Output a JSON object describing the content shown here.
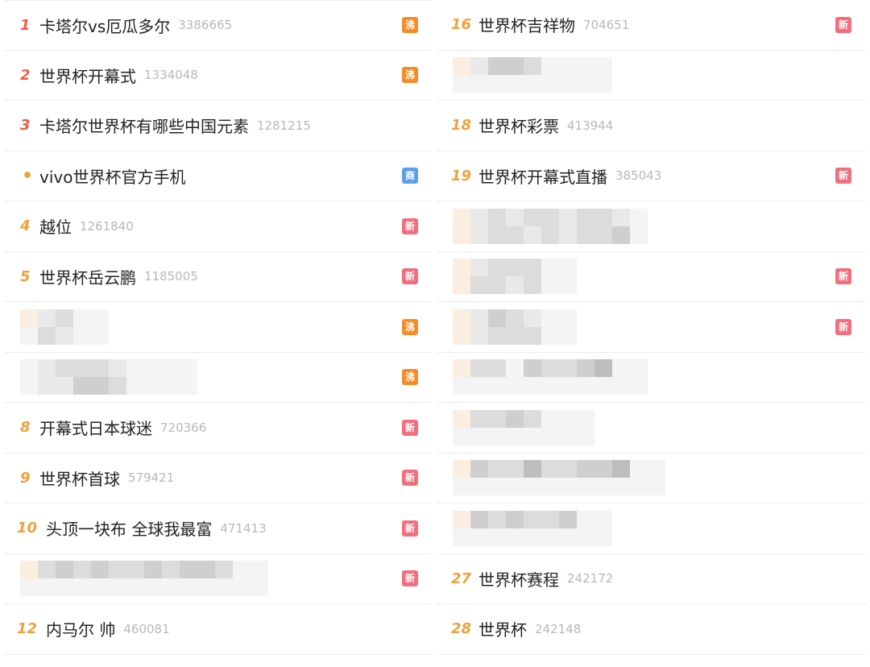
{
  "left_list": [
    {
      "rank": "1",
      "rank_style": "top",
      "title": "卡塔尔vs厄瓜多尔",
      "heat": "3386665",
      "badge": "沸",
      "badge_type": "hot"
    },
    {
      "rank": "2",
      "rank_style": "top",
      "title": "世界杯开幕式",
      "heat": "1334048",
      "badge": "沸",
      "badge_type": "hot"
    },
    {
      "rank": "3",
      "rank_style": "top",
      "title": "卡塔尔世界杯有哪些中国元素",
      "heat": "1281215",
      "badge": "",
      "badge_type": ""
    },
    {
      "rank": "•",
      "rank_style": "dot",
      "title": "vivo世界杯官方手机",
      "heat": "",
      "badge": "商",
      "badge_type": "ad"
    },
    {
      "rank": "4",
      "rank_style": "normal",
      "title": "越位",
      "heat": "1261840",
      "badge": "新",
      "badge_type": "new"
    },
    {
      "rank": "5",
      "rank_style": "normal",
      "title": "世界杯岳云鹏",
      "heat": "1185005",
      "badge": "新",
      "badge_type": "new"
    },
    {
      "blurred": true,
      "pattern": "c0c4c1c2c2c1c4c4c4c4",
      "badge": "沸",
      "badge_type": "hot"
    },
    {
      "blurred": true,
      "pattern": "c4c4c1c1c2c1c2c3c2c3c1c2c4c4c4c4c4c4c4c4",
      "badge": "沸",
      "badge_type": "hot"
    },
    {
      "rank": "8",
      "rank_style": "normal",
      "title": "开幕式日本球迷",
      "heat": "720366",
      "badge": "新",
      "badge_type": "new"
    },
    {
      "rank": "9",
      "rank_style": "normal",
      "title": "世界杯首球",
      "heat": "579421",
      "badge": "新",
      "badge_type": "new"
    },
    {
      "rank": "10",
      "rank_style": "normal",
      "title": "头顶一块布 全球我最富",
      "heat": "471413",
      "badge": "新",
      "badge_type": "new"
    },
    {
      "blurred": true,
      "pattern": "c0c4c2c4c3c4c2c4c3c4c2c4c2c4c3c4c2c4c3c4c3c4c2c4c4c4c4c4",
      "badge": "新",
      "badge_type": "new"
    },
    {
      "rank": "12",
      "rank_style": "normal",
      "title": "内马尔 帅",
      "heat": "460081",
      "badge": "",
      "badge_type": ""
    }
  ],
  "right_list": [
    {
      "rank": "16",
      "rank_style": "normal",
      "title": "世界杯吉祥物",
      "heat": "704651",
      "badge": "新",
      "badge_type": "new"
    },
    {
      "blurred": true,
      "pattern": "c0c4c1c4c3c4c3c4c2c4c4c4c4c4c4c4c4c4",
      "badge": "",
      "badge_type": ""
    },
    {
      "rank": "18",
      "rank_style": "normal",
      "title": "世界杯彩票",
      "heat": "413944",
      "badge": "",
      "badge_type": ""
    },
    {
      "rank": "19",
      "rank_style": "normal",
      "title": "世界杯开幕式直播",
      "heat": "385043",
      "badge": "新",
      "badge_type": "new"
    },
    {
      "blurred": true,
      "pattern": "c0c0c1c1c2c2c1c2c2c1c2c2c1c1c2c2c2c2c1c3c4c4",
      "badge": "",
      "badge_type": ""
    },
    {
      "blurred": true,
      "pattern": "c0c0c1c2c2c2c2c1c2c2c4c4c4c4",
      "badge": "新",
      "badge_type": "new"
    },
    {
      "blurred": true,
      "pattern": "c0c0c1c1c3c2c2c2c1c2c4c4c4c4",
      "badge": "新",
      "badge_type": "new"
    },
    {
      "blurred": true,
      "pattern": "c0c4c2c4c2c4c4c4c3c4c2c4c2c4c3c4c5c4c4c4c4c4",
      "badge": "",
      "badge_type": ""
    },
    {
      "blurred": true,
      "pattern": "c0c4c2c4c2c4c3c4c2c4c4c4c4c4c4c4",
      "badge": "",
      "badge_type": ""
    },
    {
      "blurred": true,
      "pattern": "c0c4c3c4c2c4c2c4c5c4c2c4c2c4c3c4c3c4c5c4c4c4c4c4",
      "badge": "",
      "badge_type": ""
    },
    {
      "blurred": true,
      "pattern": "c0c4c3c4c2c4c3c4c2c4c2c4c3c4c4c4c4c4",
      "badge": "",
      "badge_type": ""
    },
    {
      "rank": "27",
      "rank_style": "normal",
      "title": "世界杯赛程",
      "heat": "242172",
      "badge": "",
      "badge_type": ""
    },
    {
      "rank": "28",
      "rank_style": "normal",
      "title": "世界杯",
      "heat": "242148",
      "badge": "",
      "badge_type": ""
    }
  ],
  "colors": {
    "rank_top": "#f35b3e",
    "rank_normal": "#f3a03b",
    "badge_hot": "#f68c28",
    "badge_new": "#f26d7d",
    "badge_ad": "#5a9eef"
  }
}
